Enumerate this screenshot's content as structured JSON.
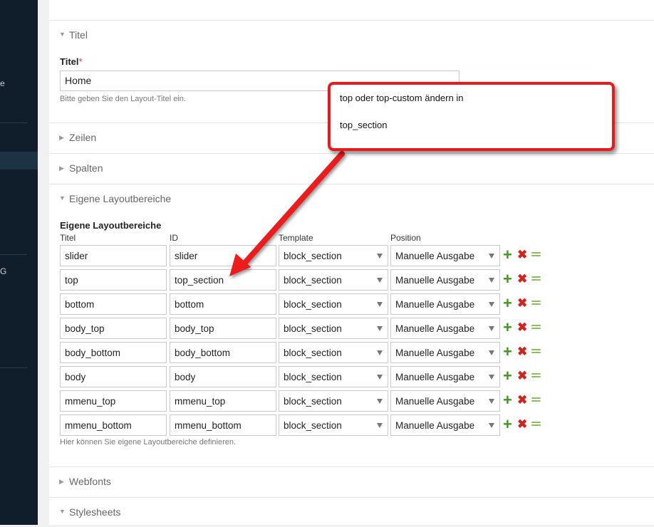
{
  "sidebar": {
    "text_e": "e",
    "text_g": "G"
  },
  "sections": {
    "titel": "Titel",
    "zeilen": "Zeilen",
    "spalten": "Spalten",
    "eigene": "Eigene Layoutbereiche",
    "webfonts": "Webfonts",
    "stylesheets": "Stylesheets"
  },
  "title_field": {
    "label": "Titel",
    "required_mark": "*",
    "value": "Home",
    "help": "Bitte geben Sie den Layout-Titel ein."
  },
  "custom_sections": {
    "label": "Eigene Layoutbereiche",
    "columns": {
      "title": "Titel",
      "id": "ID",
      "template": "Template",
      "position": "Position"
    },
    "rows": [
      {
        "title": "slider",
        "id": "slider",
        "template": "block_section",
        "position": "Manuelle Ausgabe"
      },
      {
        "title": "top",
        "id": "top_section",
        "template": "block_section",
        "position": "Manuelle Ausgabe"
      },
      {
        "title": "bottom",
        "id": "bottom",
        "template": "block_section",
        "position": "Manuelle Ausgabe"
      },
      {
        "title": "body_top",
        "id": "body_top",
        "template": "block_section",
        "position": "Manuelle Ausgabe"
      },
      {
        "title": "body_bottom",
        "id": "body_bottom",
        "template": "block_section",
        "position": "Manuelle Ausgabe"
      },
      {
        "title": "body",
        "id": "body",
        "template": "block_section",
        "position": "Manuelle Ausgabe"
      },
      {
        "title": "mmenu_top",
        "id": "mmenu_top",
        "template": "block_section",
        "position": "Manuelle Ausgabe"
      },
      {
        "title": "mmenu_bottom",
        "id": "mmenu_bottom",
        "template": "block_section",
        "position": "Manuelle Ausgabe"
      }
    ],
    "help": "Hier können Sie eigene Layoutbereiche definieren."
  },
  "annotation": {
    "line1": "top oder top-custom ändern in",
    "line2": "top_section",
    "color": "#ea1a1a"
  },
  "icons": {
    "add": "plus-icon",
    "delete": "delete-x-icon",
    "move": "drag-handle-icon"
  }
}
